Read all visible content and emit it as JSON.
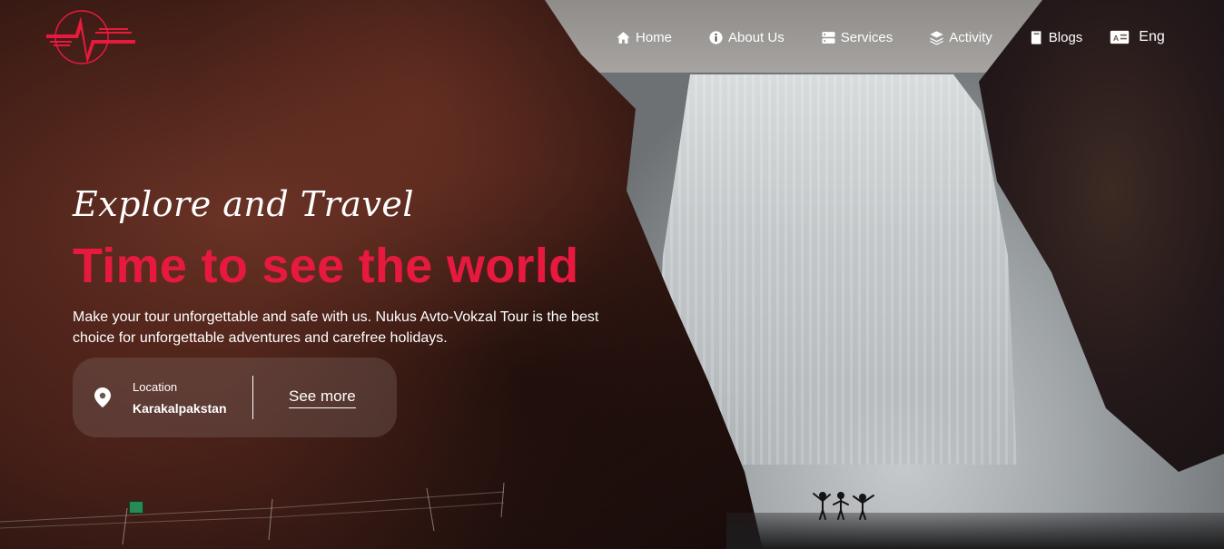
{
  "nav": {
    "items": [
      {
        "label": "Home",
        "icon": "home-icon"
      },
      {
        "label": "About Us",
        "icon": "info-icon"
      },
      {
        "label": "Services",
        "icon": "server-icon"
      },
      {
        "label": "Activity",
        "icon": "layers-icon"
      },
      {
        "label": "Blogs",
        "icon": "book-icon"
      }
    ],
    "language": {
      "label": "Eng",
      "icon": "language-icon"
    }
  },
  "hero": {
    "script_title": "Explore and Travel",
    "title": "Time to see the world",
    "description": "Make your tour unforgettable and safe with us. Nukus Avto-Vokzal Tour is the best choice for unforgettable adventures and carefree holidays.",
    "location_label": "Location",
    "location_value": "Karakalpakstan",
    "see_more": "See more"
  },
  "colors": {
    "accent": "#e8193f",
    "text": "#ffffff"
  }
}
